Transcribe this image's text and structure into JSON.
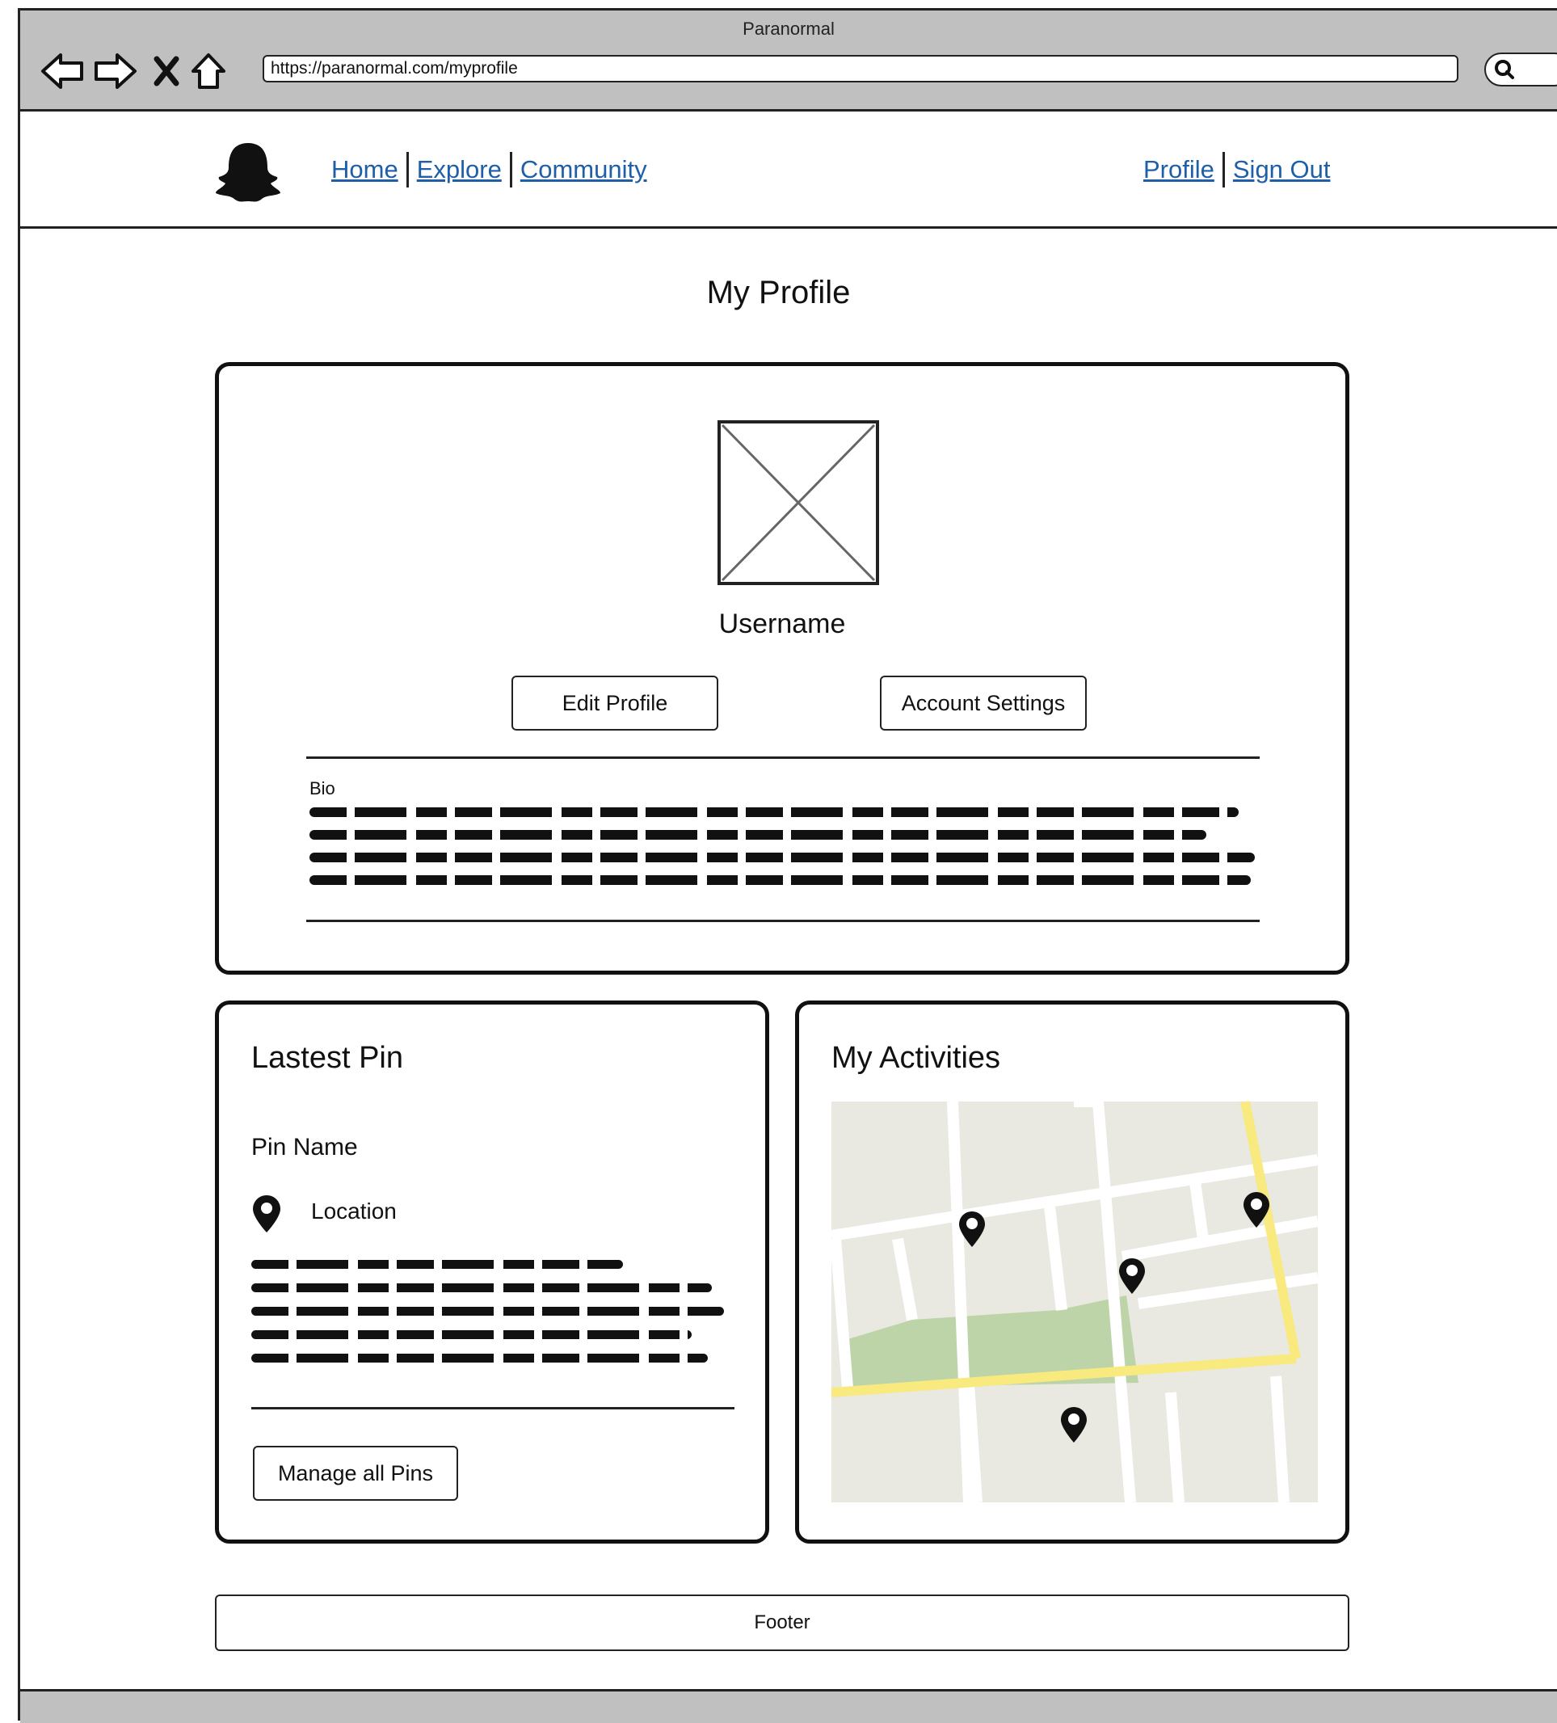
{
  "window": {
    "title": "Paranormal"
  },
  "browser": {
    "url": "https://paranormal.com/myprofile"
  },
  "nav": {
    "left_links": [
      "Home",
      "Explore",
      "Community"
    ],
    "right_links": [
      "Profile",
      "Sign Out"
    ],
    "link_color": "#1f5fa8"
  },
  "page": {
    "title": "My Profile"
  },
  "profile": {
    "username": "Username",
    "edit_label": "Edit Profile",
    "settings_label": "Account Settings",
    "bio_label": "Bio"
  },
  "latest_pin": {
    "title": "Lastest Pin",
    "pin_name": "Pin Name",
    "location": "Location",
    "manage_label": "Manage all Pins"
  },
  "activities": {
    "title": "My Activities",
    "map_colors": {
      "land": "#e9e8e1",
      "park": "#bcd4a8",
      "road": "#ffffff",
      "highway": "#f8ea7f"
    }
  },
  "footer": {
    "label": "Footer"
  }
}
